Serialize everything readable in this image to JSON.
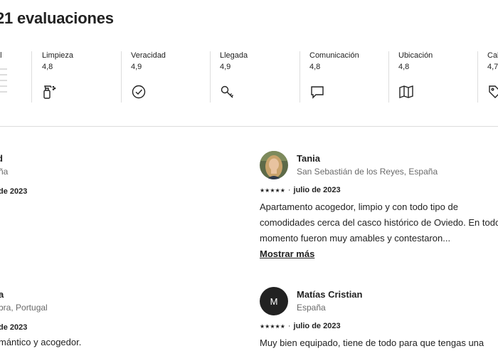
{
  "header": {
    "title": "21 evaluaciones"
  },
  "categories": [
    {
      "label": "al",
      "value": "",
      "icon": "rating-bars"
    },
    {
      "label": "Limpieza",
      "value": "4,8",
      "icon": "spray-bottle-icon"
    },
    {
      "label": "Veracidad",
      "value": "4,9",
      "icon": "check-circle-icon"
    },
    {
      "label": "Llegada",
      "value": "4,9",
      "icon": "key-icon"
    },
    {
      "label": "Comunicación",
      "value": "4,8",
      "icon": "message-icon"
    },
    {
      "label": "Ubicación",
      "value": "4,8",
      "icon": "map-icon"
    },
    {
      "label": "Cal",
      "value": "4,7",
      "icon": "tag-icon"
    }
  ],
  "reviews": {
    "left_top": {
      "name": "d",
      "location": "ña",
      "date": "de 2023"
    },
    "left_bottom": {
      "name": "a",
      "location": "bra, Portugal",
      "date": "de 2023",
      "text": "mántico y acogedor."
    },
    "right_top": {
      "name": "Tania",
      "location": "San Sebastián de los Reyes, España",
      "stars": "★★★★★",
      "separator": "·",
      "date": "julio de 2023",
      "text": "Apartamento acogedor, limpio y con todo tipo de comodidades cerca del casco histórico de Oviedo. En todo momento fueron muy amables y contestaron...",
      "show_more": "Mostrar más"
    },
    "right_bottom": {
      "name": "Matías Cristian",
      "initial": "M",
      "location": "España",
      "stars": "★★★★★",
      "separator": "·",
      "date": "julio de 2023",
      "text": "Muy bien equipado, tiene de todo para que tengas una"
    }
  }
}
